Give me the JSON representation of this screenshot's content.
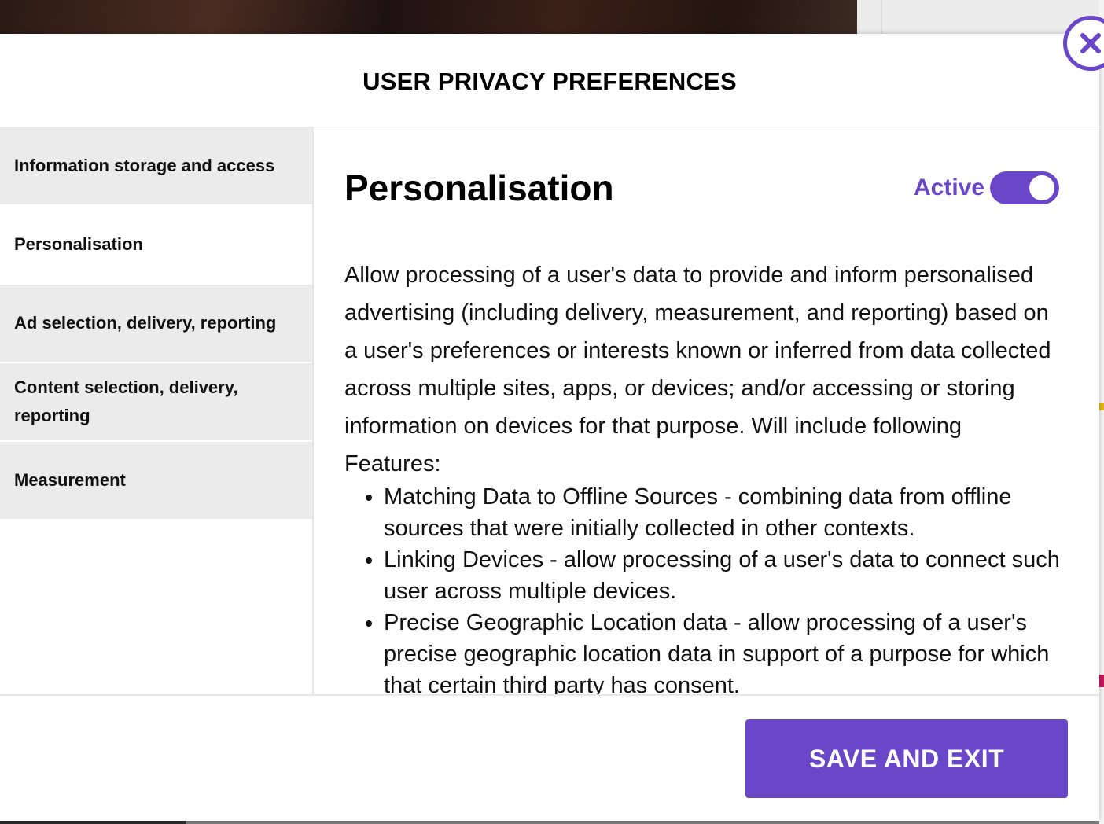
{
  "modal": {
    "title": "USER PRIVACY PREFERENCES",
    "close_icon": "close-icon"
  },
  "sidebar": {
    "items": [
      {
        "label": "Information storage and access",
        "active": false
      },
      {
        "label": "Personalisation",
        "active": true
      },
      {
        "label": "Ad selection, delivery, reporting",
        "active": false
      },
      {
        "label": "Content selection, delivery, reporting",
        "active": false
      },
      {
        "label": "Measurement",
        "active": false
      }
    ]
  },
  "content": {
    "title": "Personalisation",
    "toggle_label": "Active",
    "toggle_on": true,
    "description": "Allow processing of a user's data to provide and inform personalised advertising (including delivery, measurement, and reporting) based on a user's preferences or interests known or inferred from data collected across multiple sites, apps, or devices; and/or accessing or storing information on devices for that purpose. Will include following Features:",
    "features": [
      "Matching Data to Offline Sources - combining data from offline sources that were initially collected in other contexts.",
      "Linking Devices - allow processing of a user's data to connect such user across multiple devices.",
      "Precise Geographic Location data - allow processing of a user's precise geographic location data in support of a purpose for which that certain third party has consent."
    ]
  },
  "footer": {
    "save_label": "SAVE AND EXIT"
  },
  "colors": {
    "accent": "#6a46c9",
    "sidebar_inactive_bg": "#ebebeb"
  }
}
